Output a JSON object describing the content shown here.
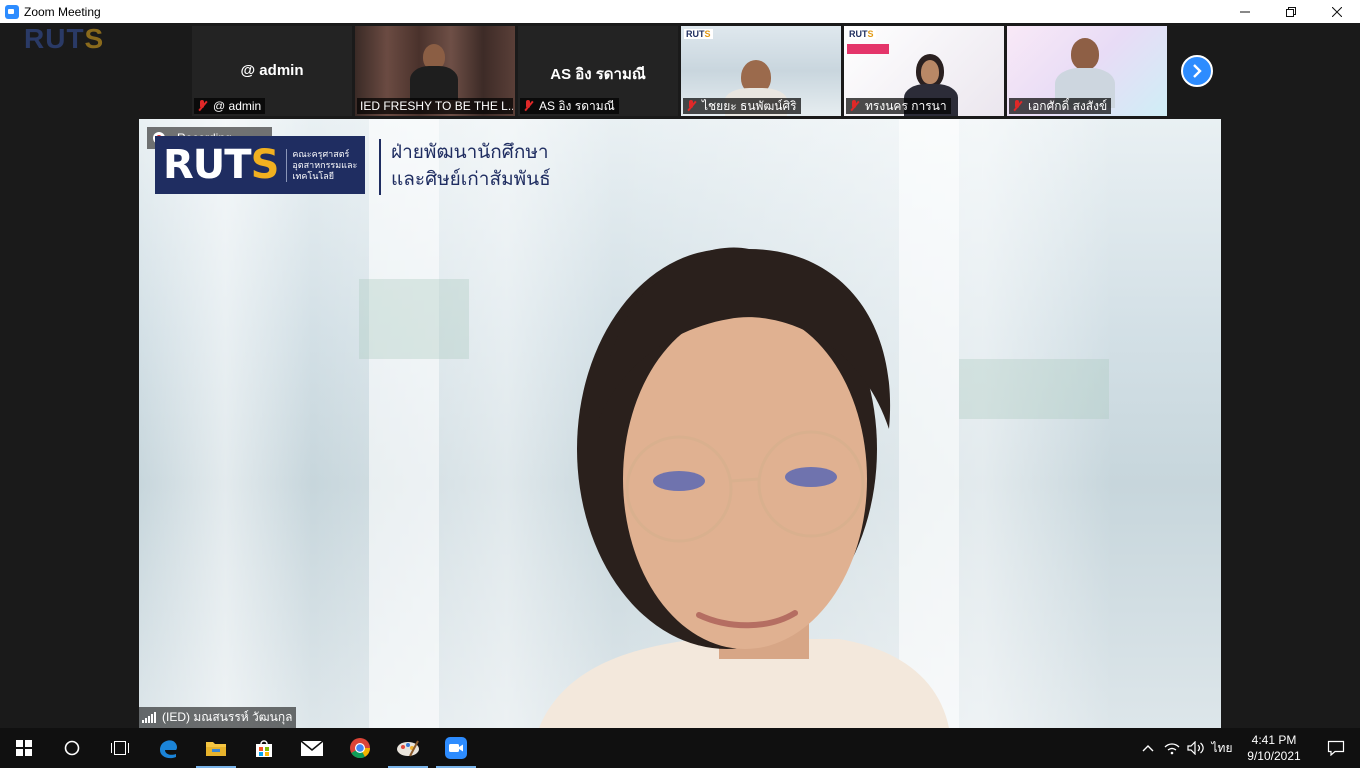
{
  "window": {
    "title": "Zoom Meeting",
    "controls": [
      "minimize",
      "restore",
      "close"
    ]
  },
  "gallery": {
    "tiles": [
      {
        "center_name": "@ admin",
        "label": "@ admin",
        "muted": true,
        "video": false
      },
      {
        "center_name": "",
        "label": "IED FRESHY TO BE THE L...",
        "muted": false,
        "video": true
      },
      {
        "center_name": "AS อิง รดามณี",
        "label": "AS อิง รดามณี",
        "muted": true,
        "video": false
      },
      {
        "center_name": "",
        "label": "ไชยยะ ธนพัฒน์ศิริ",
        "muted": true,
        "video": true
      },
      {
        "center_name": "",
        "label": "ทรงนคร การนา",
        "muted": true,
        "video": true
      },
      {
        "center_name": "",
        "label": "เอกศักดิ์ สงสังข์",
        "muted": true,
        "video": true
      }
    ],
    "next_icon": "chevron-right-icon"
  },
  "main_speaker": {
    "recording_text": "Recording...",
    "logo_text": "RUTS",
    "logo_sub_line1": "คณะครุศาสตร์",
    "logo_sub_line2": "อุตสาหกรรมและเทคโนโลยี",
    "banner_line1": "ฝ่ายพัฒนานักศึกษา",
    "banner_line2": "และศิษย์เก่าสัมพันธ์",
    "name": "(IED) มณสนรรห์ วัฒนกุล"
  },
  "taskbar": {
    "apps": [
      "windows-start",
      "search",
      "task-view",
      "edge",
      "file-explorer",
      "store",
      "mail",
      "chrome",
      "paint",
      "zoom"
    ],
    "language": "ไทย",
    "time": "4:41 PM",
    "date": "9/10/2021"
  },
  "colors": {
    "zoom_blue": "#2d8cff",
    "ruts_navy": "#1f2d61",
    "ruts_gold": "#f1b020",
    "muted_red": "#e02828"
  }
}
